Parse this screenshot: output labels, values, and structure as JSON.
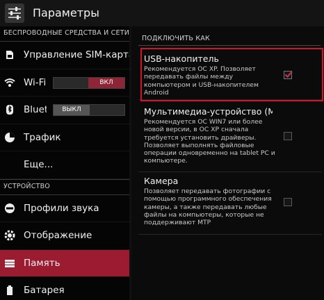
{
  "header": {
    "title": "Параметры",
    "app_icon": "settings-sliders-icon"
  },
  "left": {
    "sections": [
      {
        "title": "БЕСПРОВОДНЫЕ СРЕДСТВА И СЕТИ",
        "items": [
          {
            "label": "Управление SIM-картами",
            "icon": "sim-card-icon"
          },
          {
            "label": "Wi-Fi",
            "icon": "wifi-icon",
            "toggle": "ВКЛ",
            "toggle_state": "on"
          },
          {
            "label": "Bluetooth",
            "icon": "bluetooth-icon",
            "toggle": "ВЫКЛ",
            "toggle_state": "off"
          },
          {
            "label": "Трафик",
            "icon": "pie-chart-icon"
          },
          {
            "label": "Еще...",
            "icon": ""
          }
        ]
      },
      {
        "title": "УСТРОЙСТВО",
        "items": [
          {
            "label": "Профили звука",
            "icon": "sound-profile-icon"
          },
          {
            "label": "Отображение",
            "icon": "display-gear-icon"
          },
          {
            "label": "Память",
            "icon": "storage-icon",
            "selected": true
          },
          {
            "label": "Батарея",
            "icon": "battery-icon"
          }
        ]
      }
    ]
  },
  "right": {
    "header": "ПОДКЛЮЧИТЬ КАК",
    "options": [
      {
        "title": "USB-накопитель",
        "desc": "Рекомендуется ОС XP. Позволяет передавать файлы между компьютером и USB-накопителем Android",
        "checked": true
      },
      {
        "title": "Мультимедиа-устройство (MTP)",
        "desc": "Рекомендуется ОС WIN7 или более новой версии, в ОС XP сначала требуется установить драйверы. Позволяет выполнять файловые операции одновременно на tablet PC и компьютере.",
        "checked": false
      },
      {
        "title": "Камера",
        "desc": "Позволяет передавать фотографии с помощью программного обеспечения камеры, а также передавать любые файлы на компьютеры, которые не поддерживают MTP",
        "checked": false
      }
    ]
  },
  "colors": {
    "accent": "#9b1b30",
    "highlight": "#d0142c",
    "check": "#c0314b"
  }
}
